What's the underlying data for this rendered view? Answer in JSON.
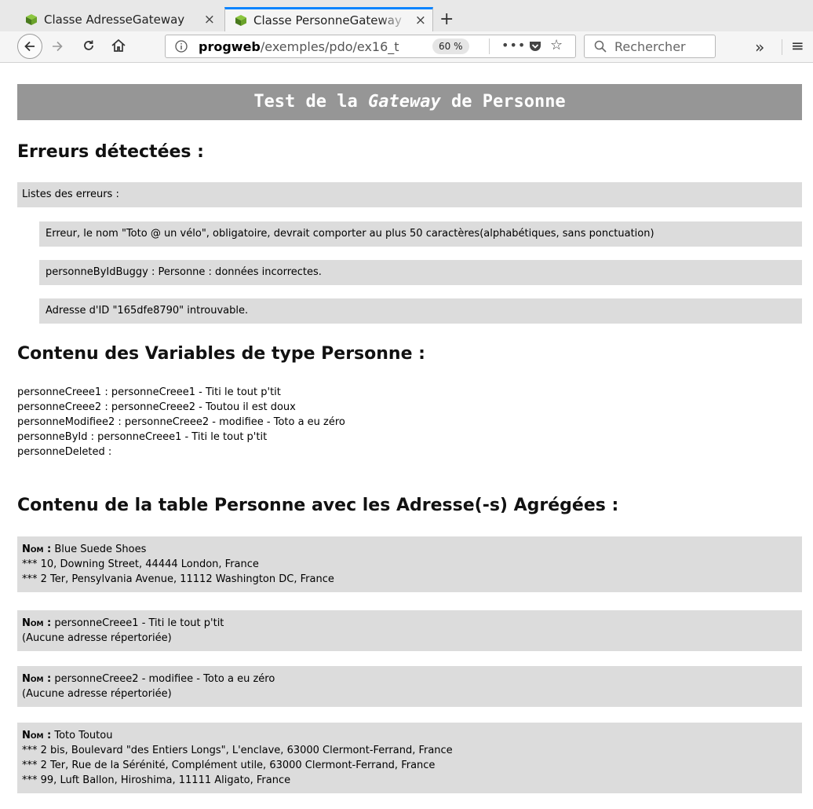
{
  "browser": {
    "tabs": [
      {
        "title": "Classe AdresseGateway",
        "close": "×",
        "active": false
      },
      {
        "title": "Classe PersonneGateway",
        "close": "×",
        "active": true
      }
    ],
    "new_tab": "+",
    "url_host": "progweb",
    "url_path": "/exemples/pdo/ex16_t",
    "zoom": "60 %",
    "more": "•••",
    "search_placeholder": "Rechercher",
    "overflow": "»",
    "menu": "≡",
    "icons": [
      "back-icon",
      "forward-icon",
      "reload-icon",
      "home-icon",
      "info-icon",
      "pocket-icon",
      "star-icon",
      "search-icon",
      "overflow-icon",
      "hamburger-menu-icon"
    ]
  },
  "page": {
    "title_prefix": "Test de la",
    "title_italic": "Gateway",
    "title_suffix": "de Personne",
    "errors_heading": "Erreurs détectées :",
    "errors_list_label": "Listes des erreurs :",
    "errors": [
      "Erreur, le nom \"Toto @ un vélo\", obligatoire, devrait comporter au plus 50 caractères(alphabétiques, sans ponctuation)",
      "personneByIdBuggy : Personne : données incorrectes.",
      "Adresse d'ID \"165dfe8790\" introuvable."
    ],
    "vars_heading": "Contenu des Variables de type Personne :",
    "vars": [
      "personneCreee1 : personneCreee1 - Titi le tout p'tit",
      "personneCreee2 : personneCreee2 - Toutou il est doux",
      "personneModifiee2 : personneCreee2 - modifiee - Toto a eu zéro",
      "personneById : personneCreee1 - Titi le tout p'tit",
      "personneDeleted :"
    ],
    "table_heading": "Contenu de la table Personne avec les Adresse(-s) Agrégées :",
    "nom_label": "Nom :",
    "records": [
      {
        "name": "Blue Suede Shoes",
        "lines": [
          "*** 10, Downing Street, 44444 London, France",
          "*** 2 Ter, Pensylvania Avenue, 11112 Washington DC, France"
        ]
      },
      {
        "name": "personneCreee1 - Titi le tout p'tit",
        "lines": [
          "(Aucune adresse répertoriée)"
        ]
      },
      {
        "name": "personneCreee2 - modifiee - Toto a eu zéro",
        "lines": [
          "(Aucune adresse répertoriée)"
        ]
      },
      {
        "name": "Toto Toutou",
        "lines": [
          "*** 2 bis, Boulevard \"des Entiers Longs\", L'enclave, 63000 Clermont-Ferrand, France",
          "*** 2 Ter, Rue de la Sérénité, Complément utile, 63000 Clermont-Ferrand, France",
          "*** 99, Luft Ballon, Hiroshima, 11111 Aligato, France"
        ]
      }
    ]
  },
  "colors": {
    "title_bg": "#969696",
    "box_bg": "#dcdcdc",
    "tab_accent": "#0a84ff"
  }
}
